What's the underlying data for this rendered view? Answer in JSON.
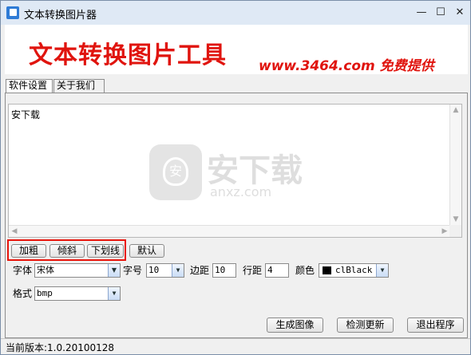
{
  "window": {
    "title": "文本转换图片器",
    "min": "—",
    "max": "☐",
    "close": "✕"
  },
  "banner": {
    "title": "文本转换图片工具",
    "subtitle": "www.3464.com 免费提供"
  },
  "tabs": [
    {
      "label": "软件设置"
    },
    {
      "label": "关于我们"
    }
  ],
  "editor": {
    "text": "安下载"
  },
  "watermark": {
    "big": "安下载",
    "small": "anxz.com",
    "shield": "安"
  },
  "format_buttons": {
    "bold": "加粗",
    "italic": "倾斜",
    "underline": "下划线",
    "default": "默认"
  },
  "settings": {
    "font_label": "字体",
    "font_value": "宋体",
    "size_label": "字号",
    "size_value": "10",
    "margin_label": "边距",
    "margin_value": "10",
    "spacing_label": "行距",
    "spacing_value": "4",
    "color_label": "颜色",
    "color_value": "clBlack",
    "format_label": "格式",
    "format_value": "bmp"
  },
  "actions": {
    "generate": "生成图像",
    "update": "检测更新",
    "exit": "退出程序"
  },
  "status": {
    "version": "当前版本:1.0.20100128"
  },
  "colors": {
    "accent_red": "#e0140e",
    "highlight_red": "#e8150c"
  }
}
